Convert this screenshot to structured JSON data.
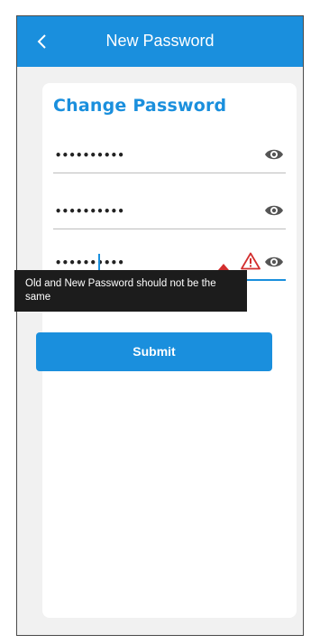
{
  "appbar": {
    "title": "New Password",
    "back_icon": "chevron-left-icon"
  },
  "form": {
    "heading": "Change Password",
    "fields": [
      {
        "masked_value": "••••••••••",
        "icon": "eye-icon"
      },
      {
        "masked_value": "••••••••••",
        "icon": "eye-icon"
      },
      {
        "masked_value": "••••••••••",
        "icon": "eye-icon",
        "error_icon": "warning-icon"
      }
    ],
    "error_message": "Old and New Password should not be the same",
    "submit_label": "Submit"
  },
  "colors": {
    "primary": "#1a8fdd",
    "error": "#d32f2f",
    "tooltip_bg": "#1c1c1c"
  }
}
